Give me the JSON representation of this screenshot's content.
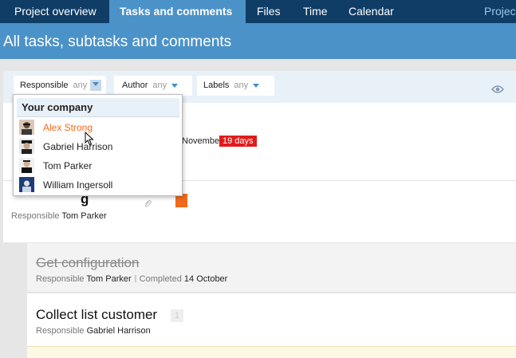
{
  "nav": {
    "tabs": [
      {
        "label": "Project overview",
        "active": false
      },
      {
        "label": "Tasks and comments",
        "active": true
      },
      {
        "label": "Files",
        "active": false
      },
      {
        "label": "Time",
        "active": false
      },
      {
        "label": "Calendar",
        "active": false
      },
      {
        "label": "Project",
        "active": false
      }
    ]
  },
  "header": {
    "title": "All tasks, subtasks and comments"
  },
  "filters": {
    "responsible": {
      "label": "Responsible",
      "value": "any"
    },
    "author": {
      "label": "Author",
      "value": "any"
    },
    "labels": {
      "label": "Labels",
      "value": "any"
    },
    "eye_icon": "eye-icon"
  },
  "dropdown": {
    "heading": "Your company",
    "people": [
      {
        "name": "Alex Strong",
        "hover": true
      },
      {
        "name": "Gabriel Harrison",
        "hover": false
      },
      {
        "name": "Tom Parker",
        "hover": false
      },
      {
        "name": "William Ingersoll",
        "hover": false
      }
    ]
  },
  "tasks": {
    "first": {
      "date_text": "November",
      "late_badge": "19 days"
    },
    "second": {
      "title": "g",
      "meta_label": "Responsible",
      "meta_value": "Tom Parker"
    },
    "get_configuration": {
      "title": "Get configuration",
      "responsible_label": "Responsible",
      "responsible_value": "Tom Parker",
      "completed_label": "Completed",
      "completed_value": "14 October"
    },
    "collect_list": {
      "title": "Collect list customer",
      "count": "1",
      "responsible_label": "Responsible",
      "responsible_value": "Gabriel Harrison"
    }
  },
  "colors": {
    "nav_bg": "#0f3d66",
    "header_bg": "#4b92c8",
    "accent_orange": "#f26a1b",
    "late_red": "#e11b1b"
  }
}
